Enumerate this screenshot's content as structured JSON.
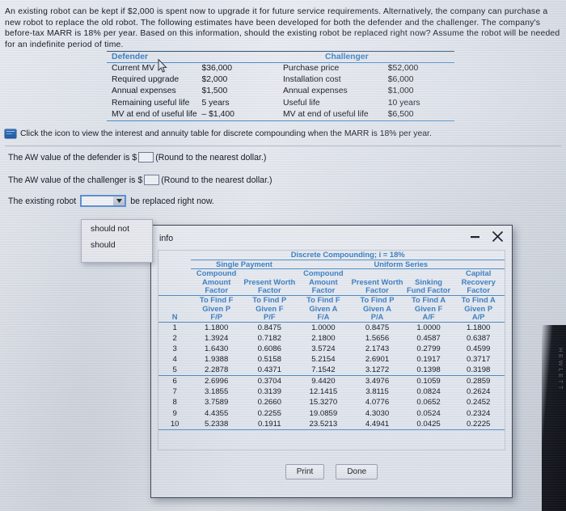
{
  "problem": {
    "statement": "An existing robot can be kept if $2,000 is spent now to upgrade it for future service requirements. Alternatively, the company can purchase a new robot to replace the old robot. The following estimates have been developed for both the defender and the challenger. The company's before-tax MARR is 18% per year. Based on this information, should the existing robot be replaced right now? Assume the robot will be needed for an indefinite period of time."
  },
  "estimates": {
    "defender_header": "Defender",
    "challenger_header": "Challenger",
    "rows": [
      {
        "d_label": "Current MV",
        "d_value": "$36,000",
        "c_label": "Purchase price",
        "c_value": "$52,000"
      },
      {
        "d_label": "Required upgrade",
        "d_value": "$2,000",
        "c_label": "Installation cost",
        "c_value": "$6,000"
      },
      {
        "d_label": "Annual expenses",
        "d_value": "$1,500",
        "c_label": "Annual expenses",
        "c_value": "$1,000"
      },
      {
        "d_label": "Remaining useful life",
        "d_value": "5 years",
        "c_label": "Useful life",
        "c_value": "10 years"
      },
      {
        "d_label": "MV at end of useful life",
        "d_value": "– $1,400",
        "c_label": "MV at end of useful life",
        "c_value": "$6,500"
      }
    ]
  },
  "icon_line": {
    "text": "Click the icon to view the interest and annuity table for discrete compounding when the MARR is 18% per year."
  },
  "answers": {
    "defender_prefix": "The AW value of the defender is $",
    "defender_value": "",
    "defender_suffix": "(Round to the nearest dollar.)",
    "challenger_prefix": "The AW value of the challenger is $",
    "challenger_value": "",
    "challenger_suffix": "(Round to the nearest dollar.)",
    "decision_prefix": "The existing robot",
    "decision_value": "",
    "decision_suffix": "be replaced right now."
  },
  "dropdown": {
    "options": [
      "should not",
      "should"
    ]
  },
  "popup": {
    "title": "info",
    "minimize_label": "minimize",
    "close_label": "close",
    "print_label": "Print",
    "done_label": "Done"
  },
  "chart_data": {
    "type": "table",
    "title": "Discrete Compounding; i = 18%",
    "group_headers": [
      "Single Payment",
      "Uniform Series"
    ],
    "column_factor_names": [
      "Compound Amount Factor",
      "Present Worth Factor",
      "Compound Amount Factor",
      "Present Worth Factor",
      "Sinking Fund Factor",
      "Capital Recovery Factor"
    ],
    "column_find_given": [
      "To Find F Given P",
      "To Find P Given F",
      "To Find F Given A",
      "To Find P Given A",
      "To Find A Given F",
      "To Find A Given P"
    ],
    "column_symbols": [
      "F/P",
      "P/F",
      "F/A",
      "P/A",
      "A/F",
      "A/P"
    ],
    "index_label": "N",
    "categories": [
      1,
      2,
      3,
      4,
      5,
      6,
      7,
      8,
      9,
      10
    ],
    "series": [
      {
        "name": "F/P",
        "values": [
          "1.1800",
          "1.3924",
          "1.6430",
          "1.9388",
          "2.2878",
          "2.6996",
          "3.1855",
          "3.7589",
          "4.4355",
          "5.2338"
        ]
      },
      {
        "name": "P/F",
        "values": [
          "0.8475",
          "0.7182",
          "0.6086",
          "0.5158",
          "0.4371",
          "0.3704",
          "0.3139",
          "0.2660",
          "0.2255",
          "0.1911"
        ]
      },
      {
        "name": "F/A",
        "values": [
          "1.0000",
          "2.1800",
          "3.5724",
          "5.2154",
          "7.1542",
          "9.4420",
          "12.1415",
          "15.3270",
          "19.0859",
          "23.5213"
        ]
      },
      {
        "name": "P/A",
        "values": [
          "0.8475",
          "1.5656",
          "2.1743",
          "2.6901",
          "3.1272",
          "3.4976",
          "3.8115",
          "4.0776",
          "4.3030",
          "4.4941"
        ]
      },
      {
        "name": "A/F",
        "values": [
          "1.0000",
          "0.4587",
          "0.2799",
          "0.1917",
          "0.1398",
          "0.1059",
          "0.0824",
          "0.0652",
          "0.0524",
          "0.0425"
        ]
      },
      {
        "name": "A/P",
        "values": [
          "1.1800",
          "0.6387",
          "0.4599",
          "0.3717",
          "0.3198",
          "0.2859",
          "0.2624",
          "0.2452",
          "0.2324",
          "0.2225"
        ]
      }
    ]
  },
  "bezel": {
    "brand": "HEWLETT"
  },
  "colors": {
    "accent_blue": "#3b7fc4",
    "rule_blue": "#4e8dc8",
    "text": "#12161f"
  }
}
